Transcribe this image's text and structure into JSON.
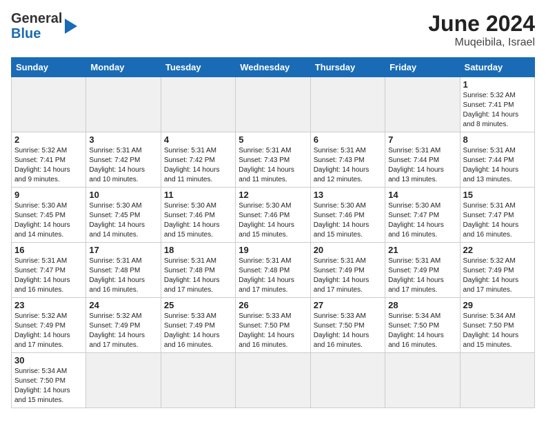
{
  "header": {
    "logo_general": "General",
    "logo_blue": "Blue",
    "month_year": "June 2024",
    "location": "Muqeibila, Israel"
  },
  "days_of_week": [
    "Sunday",
    "Monday",
    "Tuesday",
    "Wednesday",
    "Thursday",
    "Friday",
    "Saturday"
  ],
  "weeks": [
    [
      {
        "day": "",
        "empty": true
      },
      {
        "day": "",
        "empty": true
      },
      {
        "day": "",
        "empty": true
      },
      {
        "day": "",
        "empty": true
      },
      {
        "day": "",
        "empty": true
      },
      {
        "day": "",
        "empty": true
      },
      {
        "day": "1",
        "sunrise": "5:32 AM",
        "sunset": "7:41 PM",
        "daylight": "14 hours and 8 minutes."
      }
    ],
    [
      {
        "day": "2",
        "sunrise": "5:32 AM",
        "sunset": "7:41 PM",
        "daylight": "14 hours and 9 minutes."
      },
      {
        "day": "3",
        "sunrise": "5:31 AM",
        "sunset": "7:42 PM",
        "daylight": "14 hours and 10 minutes."
      },
      {
        "day": "4",
        "sunrise": "5:31 AM",
        "sunset": "7:42 PM",
        "daylight": "14 hours and 11 minutes."
      },
      {
        "day": "5",
        "sunrise": "5:31 AM",
        "sunset": "7:43 PM",
        "daylight": "14 hours and 11 minutes."
      },
      {
        "day": "6",
        "sunrise": "5:31 AM",
        "sunset": "7:43 PM",
        "daylight": "14 hours and 12 minutes."
      },
      {
        "day": "7",
        "sunrise": "5:31 AM",
        "sunset": "7:44 PM",
        "daylight": "14 hours and 13 minutes."
      },
      {
        "day": "8",
        "sunrise": "5:31 AM",
        "sunset": "7:44 PM",
        "daylight": "14 hours and 13 minutes."
      }
    ],
    [
      {
        "day": "9",
        "sunrise": "5:30 AM",
        "sunset": "7:45 PM",
        "daylight": "14 hours and 14 minutes."
      },
      {
        "day": "10",
        "sunrise": "5:30 AM",
        "sunset": "7:45 PM",
        "daylight": "14 hours and 14 minutes."
      },
      {
        "day": "11",
        "sunrise": "5:30 AM",
        "sunset": "7:46 PM",
        "daylight": "14 hours and 15 minutes."
      },
      {
        "day": "12",
        "sunrise": "5:30 AM",
        "sunset": "7:46 PM",
        "daylight": "14 hours and 15 minutes."
      },
      {
        "day": "13",
        "sunrise": "5:30 AM",
        "sunset": "7:46 PM",
        "daylight": "14 hours and 15 minutes."
      },
      {
        "day": "14",
        "sunrise": "5:30 AM",
        "sunset": "7:47 PM",
        "daylight": "14 hours and 16 minutes."
      },
      {
        "day": "15",
        "sunrise": "5:31 AM",
        "sunset": "7:47 PM",
        "daylight": "14 hours and 16 minutes."
      }
    ],
    [
      {
        "day": "16",
        "sunrise": "5:31 AM",
        "sunset": "7:47 PM",
        "daylight": "14 hours and 16 minutes."
      },
      {
        "day": "17",
        "sunrise": "5:31 AM",
        "sunset": "7:48 PM",
        "daylight": "14 hours and 16 minutes."
      },
      {
        "day": "18",
        "sunrise": "5:31 AM",
        "sunset": "7:48 PM",
        "daylight": "14 hours and 17 minutes."
      },
      {
        "day": "19",
        "sunrise": "5:31 AM",
        "sunset": "7:48 PM",
        "daylight": "14 hours and 17 minutes."
      },
      {
        "day": "20",
        "sunrise": "5:31 AM",
        "sunset": "7:49 PM",
        "daylight": "14 hours and 17 minutes."
      },
      {
        "day": "21",
        "sunrise": "5:31 AM",
        "sunset": "7:49 PM",
        "daylight": "14 hours and 17 minutes."
      },
      {
        "day": "22",
        "sunrise": "5:32 AM",
        "sunset": "7:49 PM",
        "daylight": "14 hours and 17 minutes."
      }
    ],
    [
      {
        "day": "23",
        "sunrise": "5:32 AM",
        "sunset": "7:49 PM",
        "daylight": "14 hours and 17 minutes."
      },
      {
        "day": "24",
        "sunrise": "5:32 AM",
        "sunset": "7:49 PM",
        "daylight": "14 hours and 17 minutes."
      },
      {
        "day": "25",
        "sunrise": "5:33 AM",
        "sunset": "7:49 PM",
        "daylight": "14 hours and 16 minutes."
      },
      {
        "day": "26",
        "sunrise": "5:33 AM",
        "sunset": "7:50 PM",
        "daylight": "14 hours and 16 minutes."
      },
      {
        "day": "27",
        "sunrise": "5:33 AM",
        "sunset": "7:50 PM",
        "daylight": "14 hours and 16 minutes."
      },
      {
        "day": "28",
        "sunrise": "5:34 AM",
        "sunset": "7:50 PM",
        "daylight": "14 hours and 16 minutes."
      },
      {
        "day": "29",
        "sunrise": "5:34 AM",
        "sunset": "7:50 PM",
        "daylight": "14 hours and 15 minutes."
      }
    ],
    [
      {
        "day": "30",
        "sunrise": "5:34 AM",
        "sunset": "7:50 PM",
        "daylight": "14 hours and 15 minutes."
      },
      {
        "day": "",
        "empty": true
      },
      {
        "day": "",
        "empty": true
      },
      {
        "day": "",
        "empty": true
      },
      {
        "day": "",
        "empty": true
      },
      {
        "day": "",
        "empty": true
      },
      {
        "day": "",
        "empty": true
      }
    ]
  ]
}
